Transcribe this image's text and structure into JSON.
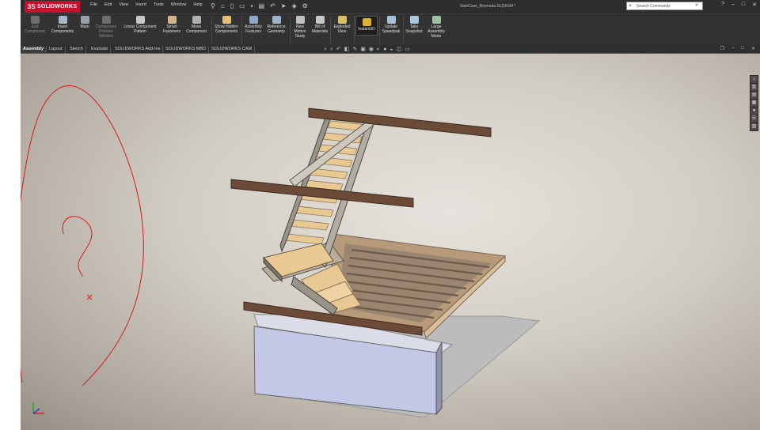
{
  "app": {
    "logo_text": "SOLIDWORKS",
    "logo_mark": "3S",
    "document_title": "StairCase_Bermuda.SLDASM *",
    "menus": [
      "File",
      "Edit",
      "View",
      "Insert",
      "Tools",
      "Window",
      "Help"
    ],
    "quick_icons": [
      "pin-icon",
      "home-icon",
      "new-icon",
      "open-icon",
      "save-icon",
      "print-icon",
      "undo-icon",
      "select-icon",
      "rebuild-icon",
      "options-icon"
    ],
    "search_placeholder": "Search Commands",
    "window_controls": [
      "?",
      "–",
      "□",
      "✕"
    ]
  },
  "ribbon": {
    "buttons": [
      {
        "label": "Edit Component",
        "enabled": false,
        "icon": "edit-component-icon",
        "color": "#7a7a7a"
      },
      {
        "label": "Insert Components",
        "enabled": true,
        "icon": "insert-components-icon",
        "color": "#a8b8c8"
      },
      {
        "label": "Mate",
        "enabled": true,
        "icon": "mate-icon",
        "color": "#9aa0a8"
      },
      {
        "label": "Component Preview Window",
        "enabled": false,
        "icon": "preview-window-icon",
        "color": "#6e6e6e"
      },
      {
        "label": "Linear Component Pattern",
        "enabled": true,
        "icon": "linear-pattern-icon",
        "color": "#c8c8c8"
      },
      {
        "label": "Smart Fasteners",
        "enabled": true,
        "icon": "smart-fasteners-icon",
        "color": "#d2b48c"
      },
      {
        "label": "Move Component",
        "enabled": true,
        "icon": "move-component-icon",
        "color": "#b0b0b0"
      },
      {
        "label": "Show Hidden Components",
        "enabled": true,
        "icon": "show-hidden-icon",
        "color": "#e0c070"
      },
      {
        "label": "Assembly Features",
        "enabled": true,
        "icon": "assembly-features-icon",
        "color": "#8fa8c8"
      },
      {
        "label": "Reference Geometry",
        "enabled": true,
        "icon": "reference-geometry-icon",
        "color": "#9cb4cc"
      },
      {
        "label": "New Motion Study",
        "enabled": true,
        "icon": "motion-study-icon",
        "color": "#c0c0c0"
      },
      {
        "label": "Bill of Materials",
        "enabled": true,
        "icon": "bill-of-materials-icon",
        "color": "#c8c8c8"
      },
      {
        "label": "Exploded View",
        "enabled": true,
        "icon": "exploded-view-icon",
        "color": "#d8c060"
      },
      {
        "label": "Instant3D",
        "enabled": true,
        "icon": "instant3d-icon",
        "color": "#e0b030",
        "active": true
      },
      {
        "label": "Update Speedpak",
        "enabled": true,
        "icon": "speedpak-icon",
        "color": "#a8c0d8"
      },
      {
        "label": "Take Snapshot",
        "enabled": true,
        "icon": "snapshot-icon",
        "color": "#a8c8e0"
      },
      {
        "label": "Large Assembly Mode",
        "enabled": true,
        "icon": "large-assembly-icon",
        "color": "#9cc0a0"
      }
    ]
  },
  "tabs": [
    {
      "label": "Assembly",
      "active": true
    },
    {
      "label": "Layout",
      "active": false
    },
    {
      "label": "Sketch",
      "active": false
    },
    {
      "label": "Evaluate",
      "active": false
    },
    {
      "label": "SOLIDWORKS Add-Ins",
      "active": false
    },
    {
      "label": "SOLIDWORKS MBD",
      "active": false
    },
    {
      "label": "SOLIDWORKS CAM",
      "active": false
    }
  ],
  "view_toolbar_icons": [
    "zoom-fit-icon",
    "zoom-area-icon",
    "previous-view-icon",
    "section-view-icon",
    "dynamic-annotation-icon",
    "view-orientation-icon",
    "display-style-icon",
    "hide-show-icon",
    "edit-appearance-icon",
    "scene-icon",
    "view-settings-icon",
    "monitor-icon"
  ],
  "task_pane_icons": [
    "resources-icon",
    "design-library-icon",
    "file-explorer-icon",
    "view-palette-icon",
    "appearances-icon",
    "custom-properties-icon",
    "forum-icon"
  ],
  "colors": {
    "app_bg": "#2b2b2b",
    "ribbon_bg": "#323232",
    "brand_red": "#c8102e",
    "stringer": "#9a9488",
    "tread": "#e8c994",
    "beam": "#6b4a38",
    "deck_frame": "#c9ad8c",
    "deck_slat": "#8f7a64",
    "base_block": "#c3c8e6",
    "slab": "#bcbcbc",
    "annotation_red": "#d81818"
  },
  "annotation": {
    "description_mark": "?"
  }
}
